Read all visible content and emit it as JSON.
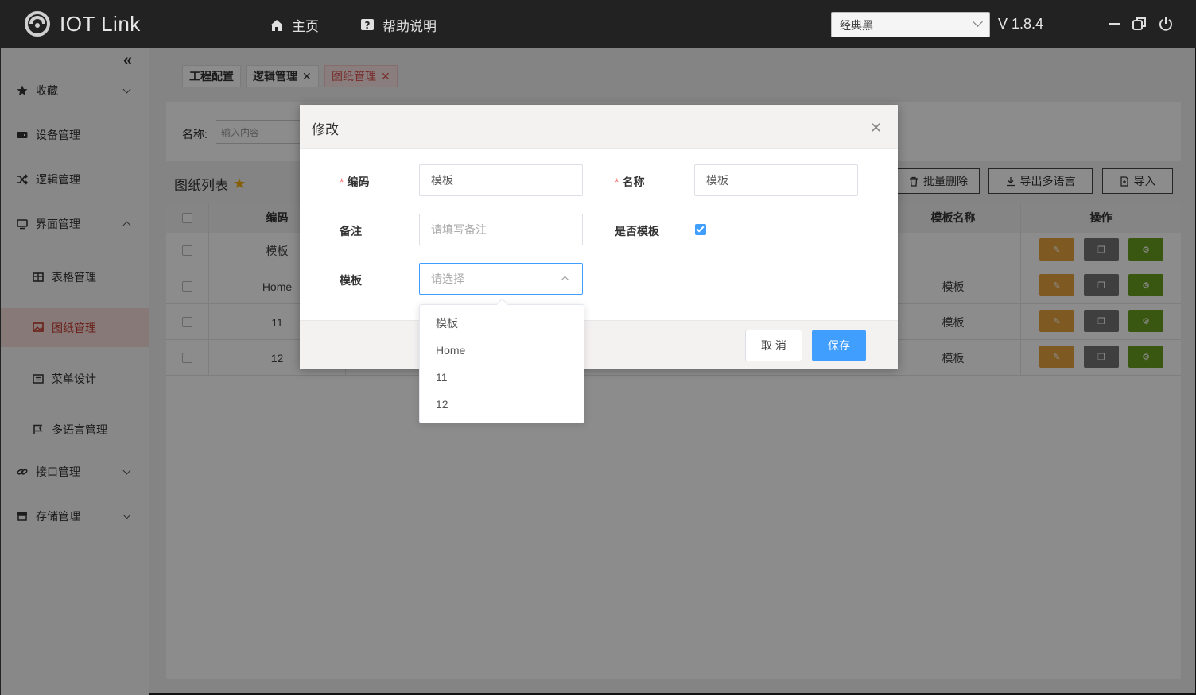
{
  "app": {
    "title": "IOT Link",
    "version": "V 1.8.4"
  },
  "nav": {
    "home": "主页",
    "help": "帮助说明"
  },
  "theme": {
    "selected": "经典黑"
  },
  "sidebar": {
    "items": [
      {
        "label": "收藏"
      },
      {
        "label": "设备管理"
      },
      {
        "label": "逻辑管理"
      },
      {
        "label": "界面管理"
      },
      {
        "label": "表格管理"
      },
      {
        "label": "图纸管理"
      },
      {
        "label": "菜单设计"
      },
      {
        "label": "多语言管理"
      },
      {
        "label": "接口管理"
      },
      {
        "label": "存储管理"
      }
    ]
  },
  "tabs": [
    {
      "label": "工程配置"
    },
    {
      "label": "逻辑管理"
    },
    {
      "label": "图纸管理"
    }
  ],
  "search": {
    "label": "名称:",
    "placeholder": "输入内容"
  },
  "list": {
    "title": "图纸列表",
    "buttons": {
      "batch_delete": "批量删除",
      "export_lang": "导出多语言",
      "import": "导入"
    }
  },
  "table": {
    "headers": {
      "code": "编码",
      "template_name": "模板名称",
      "actions": "操作"
    },
    "rows": [
      {
        "code": "模板",
        "template_name": ""
      },
      {
        "code": "Home",
        "template_name": "模板"
      },
      {
        "code": "11",
        "template_name": "模板"
      },
      {
        "code": "12",
        "template_name": "模板"
      }
    ]
  },
  "dialog": {
    "title": "修改",
    "fields": {
      "code_label": "编码",
      "code_value": "模板",
      "name_label": "名称",
      "name_value": "模板",
      "remark_label": "备注",
      "remark_placeholder": "请填写备注",
      "is_template_label": "是否模板",
      "is_template_checked": true,
      "template_label": "模板",
      "template_placeholder": "请选择"
    },
    "cancel": "取 消",
    "save": "保存"
  },
  "dropdown": {
    "options": [
      "模板",
      "Home",
      "11",
      "12"
    ]
  },
  "colors": {
    "accent": "#409eff",
    "active_menu": "#c0392b",
    "edit": "#e6a23c",
    "copy": "#747474",
    "settings": "#6a9e1f"
  }
}
